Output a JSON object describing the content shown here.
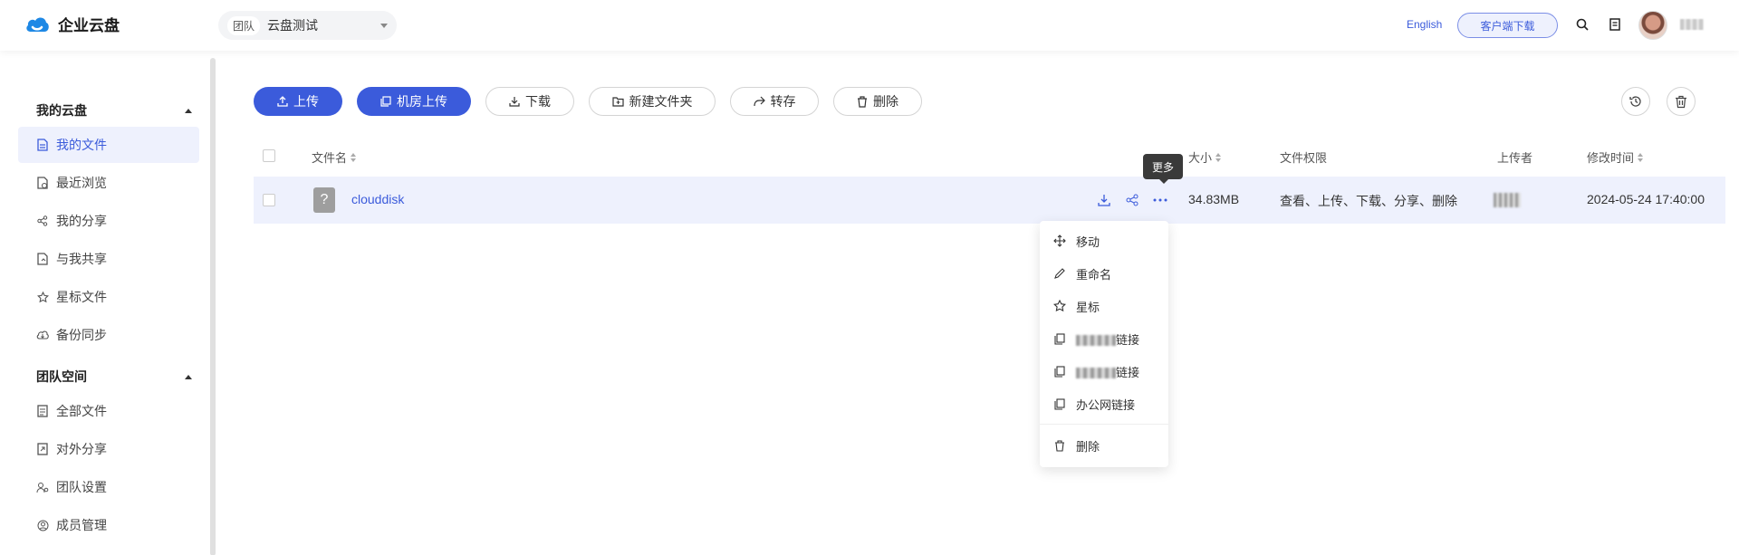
{
  "header": {
    "app_name": "企业云盘",
    "team_tag": "团队",
    "team_name": "云盘测试",
    "language": "English",
    "client_download": "客户端下载"
  },
  "sidebar": {
    "my_group": "我的云盘",
    "my_items": [
      {
        "label": "我的文件",
        "icon": "file-icon",
        "active": true
      },
      {
        "label": "最近浏览",
        "icon": "recent-file-icon"
      },
      {
        "label": "我的分享",
        "icon": "share-icon"
      },
      {
        "label": "与我共享",
        "icon": "shared-with-me-icon"
      },
      {
        "label": "星标文件",
        "icon": "star-icon"
      },
      {
        "label": "备份同步",
        "icon": "cloud-sync-icon"
      }
    ],
    "team_group": "团队空间",
    "team_items": [
      {
        "label": "全部文件",
        "icon": "document-icon"
      },
      {
        "label": "对外分享",
        "icon": "external-share-icon"
      },
      {
        "label": "团队设置",
        "icon": "team-settings-icon"
      },
      {
        "label": "成员管理",
        "icon": "member-icon"
      }
    ]
  },
  "toolbar": {
    "upload": "上传",
    "room_upload": "机房上传",
    "download": "下载",
    "new_folder": "新建文件夹",
    "transfer": "转存",
    "delete": "删除"
  },
  "table": {
    "columns": {
      "name": "文件名",
      "size": "大小",
      "permission": "文件权限",
      "uploader": "上传者",
      "modified": "修改时间"
    },
    "rows": [
      {
        "name": "clouddisk",
        "size": "34.83MB",
        "permission": "查看、上传、下载、分享、删除",
        "modified": "2024-05-24 17:40:00"
      }
    ]
  },
  "tooltip": "更多",
  "context_menu": {
    "move": "移动",
    "rename": "重命名",
    "star": "星标",
    "link_a_suffix": "链接",
    "link_b_suffix": "链接",
    "office_link": "办公网链接",
    "delete": "删除"
  },
  "colors": {
    "accent": "#3b5bdb",
    "active_bg": "#eef1fd"
  }
}
